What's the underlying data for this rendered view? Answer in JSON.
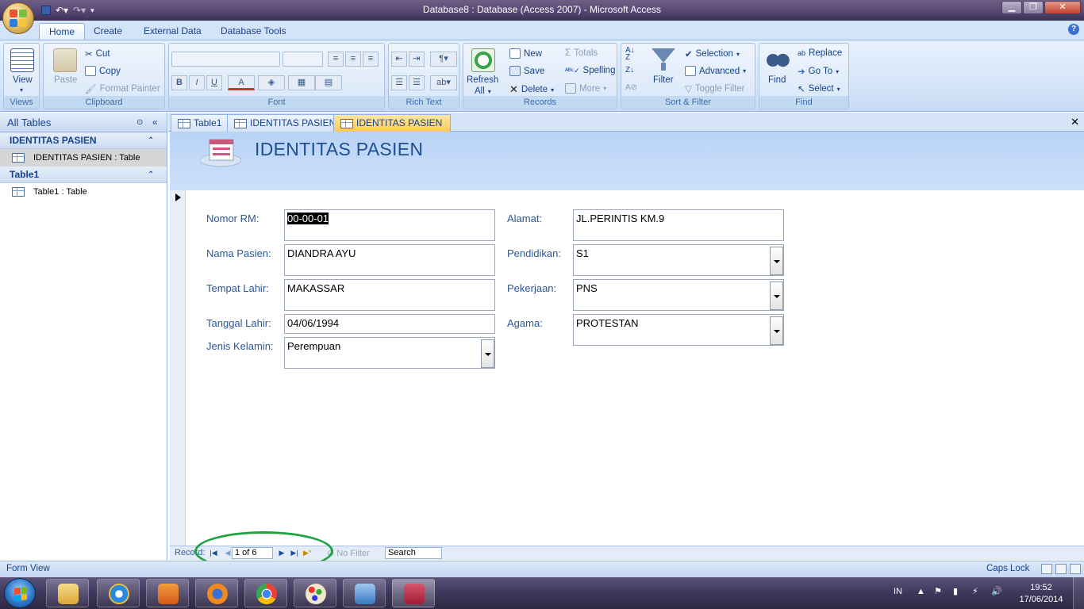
{
  "window": {
    "title": "Database8 : Database (Access 2007) - Microsoft Access"
  },
  "ribbon": {
    "tabs": [
      "Home",
      "Create",
      "External Data",
      "Database Tools"
    ],
    "active_tab": "Home",
    "groups": {
      "views": {
        "title": "Views",
        "view": "View"
      },
      "clipboard": {
        "title": "Clipboard",
        "paste": "Paste",
        "cut": "Cut",
        "copy": "Copy",
        "format_painter": "Format Painter"
      },
      "font": {
        "title": "Font",
        "bold": "B",
        "italic": "I",
        "underline": "U",
        "font_color": "A"
      },
      "rich_text": {
        "title": "Rich Text"
      },
      "records": {
        "title": "Records",
        "refresh": "Refresh",
        "refresh_all": "All",
        "new": "New",
        "save": "Save",
        "delete": "Delete",
        "totals": "Totals",
        "spelling": "Spelling",
        "more": "More"
      },
      "sort_filter": {
        "title": "Sort & Filter",
        "filter": "Filter",
        "selection": "Selection",
        "advanced": "Advanced",
        "toggle_filter": "Toggle Filter"
      },
      "find": {
        "title": "Find",
        "find": "Find",
        "replace": "Replace",
        "go_to": "Go To",
        "select": "Select"
      }
    }
  },
  "nav_pane": {
    "header": "All Tables",
    "groups": [
      {
        "label": "IDENTITAS PASIEN",
        "items": [
          {
            "label": "IDENTITAS PASIEN : Table",
            "selected": true
          }
        ]
      },
      {
        "label": "Table1",
        "items": [
          {
            "label": "Table1 : Table",
            "selected": false
          }
        ]
      }
    ]
  },
  "doc_tabs": [
    {
      "label": "Table1",
      "active": false
    },
    {
      "label": "IDENTITAS PASIEN",
      "active": false
    },
    {
      "label": "IDENTITAS PASIEN",
      "active": true
    }
  ],
  "form": {
    "title": "IDENTITAS PASIEN",
    "fields": {
      "nomor_rm": {
        "label": "Nomor RM:",
        "value": "00-00-01"
      },
      "nama_pasien": {
        "label": "Nama Pasien:",
        "value": "DIANDRA AYU"
      },
      "tempat_lahir": {
        "label": "Tempat Lahir:",
        "value": "MAKASSAR"
      },
      "tanggal_lahir": {
        "label": "Tanggal Lahir:",
        "value": "04/06/1994"
      },
      "jenis_kelamin": {
        "label": "Jenis Kelamin:",
        "value": "Perempuan"
      },
      "alamat": {
        "label": "Alamat:",
        "value": "JL.PERINTIS KM.9"
      },
      "pendidikan": {
        "label": "Pendidikan:",
        "value": "S1"
      },
      "pekerjaan": {
        "label": "Pekerjaan:",
        "value": "PNS"
      },
      "agama": {
        "label": "Agama:",
        "value": "PROTESTAN"
      }
    }
  },
  "record_nav": {
    "label": "Record:",
    "position": "1 of 6",
    "no_filter": "No Filter",
    "search": "Search"
  },
  "status_bar": {
    "view": "Form View",
    "caps_lock": "Caps Lock"
  },
  "taskbar": {
    "language": "IN",
    "time": "19:52",
    "date": "17/06/2014"
  },
  "colors": {
    "ribbon_text": "#15428b",
    "active_doc_tab": "#fbc95c",
    "form_header": "#b9d3f6",
    "annotation_ellipse": "#20a240"
  }
}
